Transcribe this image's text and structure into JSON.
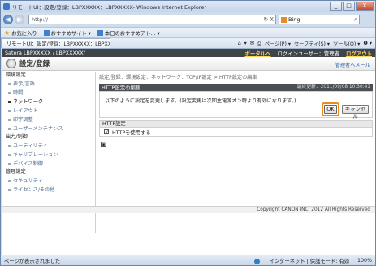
{
  "window": {
    "title": "リモートUI：設定/登録：LBPXXXXX：LBPXXXXX- Windows Internet Explorer",
    "min": "_",
    "max": "□",
    "close": "X"
  },
  "nav": {
    "back": "◀",
    "forward": "▶"
  },
  "address": {
    "url": "http://",
    "refresh": "↻",
    "stop": "X",
    "search_value": "Bing",
    "search_icon": "⌕"
  },
  "favorites": {
    "label": "お気に入り",
    "item1": "おすすめサイト ▾",
    "item2": "本日のおすすめアト... ▾"
  },
  "tab": {
    "label": "リモートUI：設定/登録：LBPXXXXX：LBPXX..."
  },
  "tools": {
    "home": "⌂",
    "feeds": "▾",
    "mail": "✉",
    "print": "⎙",
    "page": "ページ(P) ▾",
    "safety": "セーフティ(S) ▾",
    "tools": "ツール(O) ▾",
    "help": "❷ ▾"
  },
  "topbar": {
    "device": "Satera   LBPXXXXX / LBPXXXXX/",
    "portal": "ポータルへ",
    "user": "ログインユーザー：管理者",
    "logout": "ログアウト"
  },
  "header": {
    "title": "設定/登録",
    "admin_link": "管理者へメール"
  },
  "sidebar": {
    "section1": "環境設定",
    "items1": [
      "表示/言語",
      "時間",
      "ネットワーク",
      "レイアウト",
      "印字調整",
      "ユーザーメンテナンス"
    ],
    "section2": "出力/制御",
    "items2": [
      "ユーティリティ",
      "キャリブレーション",
      "デバイス制御"
    ],
    "section3": "管理設定",
    "items3": [
      "セキュリティ",
      "ライセンス/その他"
    ]
  },
  "breadcrumb": "設定/登録：環境設定：ネットワーク：TCP/IP設定 > HTTP設定の編集",
  "panel": {
    "title": "HTTP設定の編集",
    "updated": "最終更新：2011/09/08 10:30:41"
  },
  "message": "以下のように設定を変更します。(設定変更は次回主電源オン時より有効になります。)",
  "buttons": {
    "ok": "OK",
    "cancel": "キャンセル"
  },
  "http": {
    "heading": "HTTP設定",
    "checkbox_mark": "✓",
    "option": "HTTPを使用する"
  },
  "mini_button": "▣",
  "copyright": "Copyright CANON INC. 2012 All Rights Reserved",
  "status": {
    "left": "ページが表示されました",
    "zone": "インターネット | 保護モード: 有効",
    "zoom": "100%"
  }
}
